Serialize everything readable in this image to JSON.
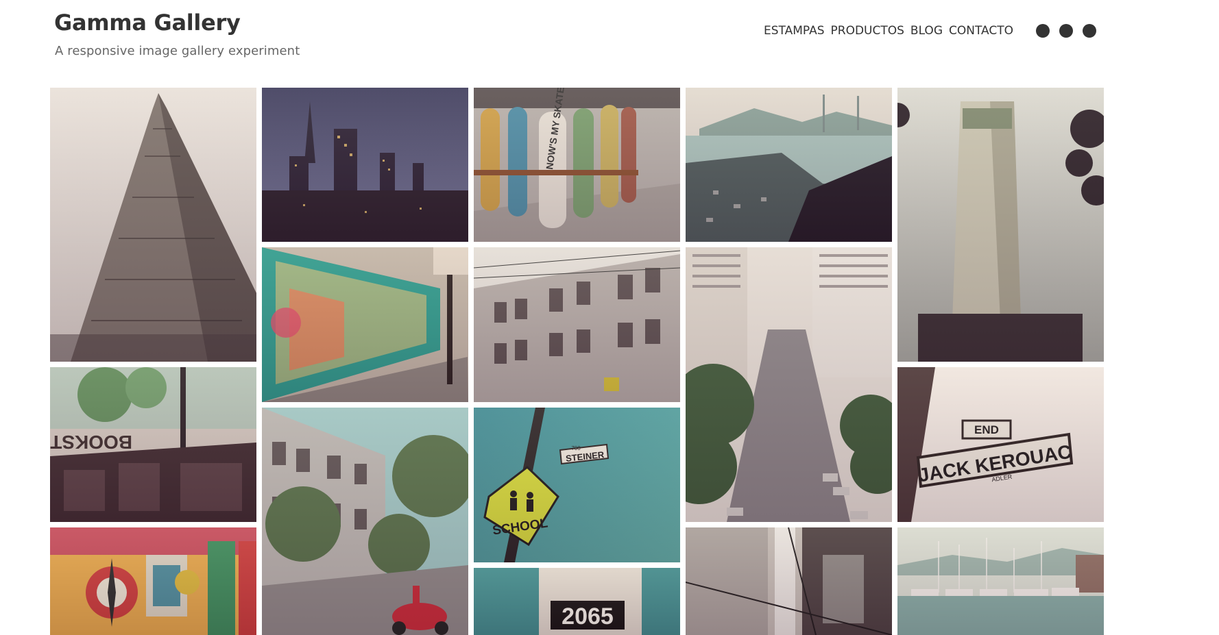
{
  "header": {
    "title": "Gamma Gallery",
    "tagline": "A responsive image gallery experiment"
  },
  "nav": {
    "links": [
      "ESTAMPAS",
      "PRODUCTOS",
      "BLOG",
      "CONTACTO"
    ]
  },
  "gallery": {
    "photos": [
      {
        "name": "flatiron-building-photo",
        "text": ""
      },
      {
        "name": "city-skyline-night-photo",
        "text": ""
      },
      {
        "name": "skateboard-planter-photo",
        "text": "NOW'S MY SKATE BOARD"
      },
      {
        "name": "bay-view-golden-gate-photo",
        "text": ""
      },
      {
        "name": "coit-tower-photo",
        "text": ""
      },
      {
        "name": "mural-sidewalk-photo",
        "text": ""
      },
      {
        "name": "victorian-houses-photo",
        "text": ""
      },
      {
        "name": "steep-street-photo",
        "text": ""
      },
      {
        "name": "bookstore-window-photo",
        "text": "BOOKSTORE"
      },
      {
        "name": "jack-kerouac-sign-photo",
        "text": "JACK KEROUAC",
        "subtext": "END",
        "footnote": "ADLER"
      },
      {
        "name": "painted-ladies-scooter-photo",
        "text": ""
      },
      {
        "name": "school-sign-photo",
        "text": "SCHOOL",
        "subtext": "STEINER",
        "footnote": "700"
      },
      {
        "name": "colorful-mural-photo",
        "text": ""
      },
      {
        "name": "house-number-photo",
        "text": "2065"
      },
      {
        "name": "window-wires-photo",
        "text": ""
      },
      {
        "name": "marina-boats-photo",
        "text": ""
      }
    ]
  },
  "colors": {
    "title": "#333333",
    "tagline": "#666666",
    "nav_text": "#333333",
    "dot": "#333333"
  }
}
